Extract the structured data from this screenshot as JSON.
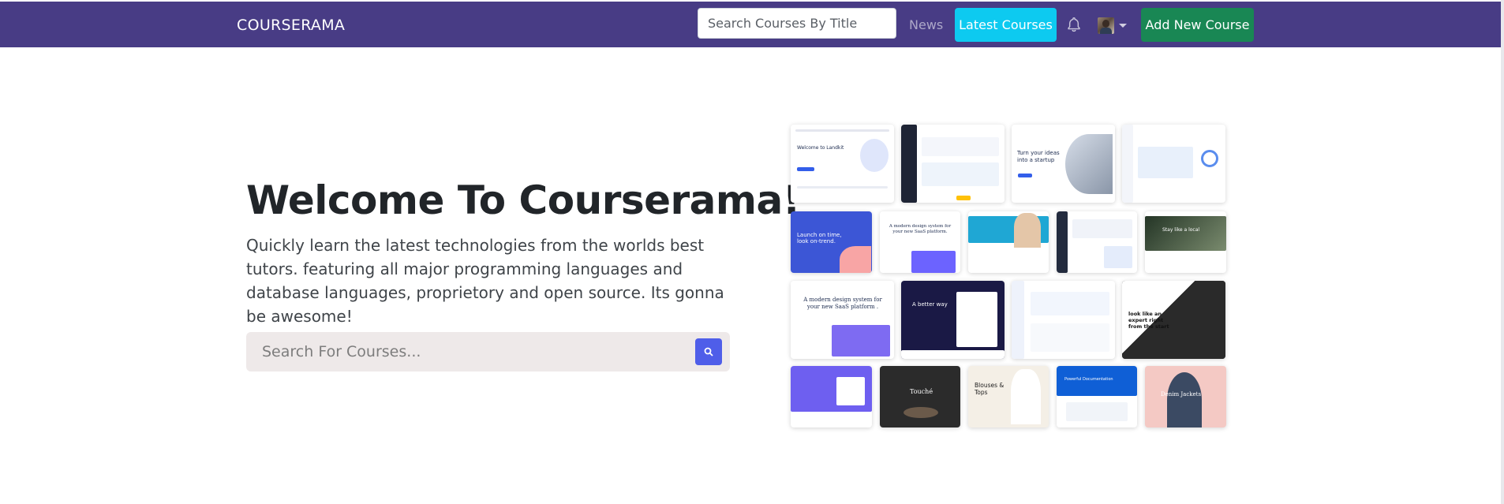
{
  "navbar": {
    "brand": "COURSERAMA",
    "search_placeholder": "Search Courses By Title",
    "news_label": "News",
    "latest_courses_label": "Latest Courses",
    "add_course_label": "Add New Course",
    "bell_icon": "bell-icon",
    "avatar_icon": "user-avatar",
    "dropdown_icon": "caret-down-icon"
  },
  "hero": {
    "title": "Welcome To Courserama!",
    "lead": "Quickly learn the latest technologies from the worlds best tutors. featuring all major programming languages and database languages, proprietory and open source. Its gonna be awesome!",
    "search_placeholder": "Search For Courses...",
    "search_icon": "search-icon"
  },
  "mosaic_texts": {
    "t1": "Welcome to Landkit",
    "t3": "Turn your ideas into a startup",
    "t5": "Launch on time, look on-trend.",
    "t6": "A modern design system for your new SaaS platform.",
    "t10": "Stay like a local",
    "t11": "A modern design system for your new SaaS platform .",
    "t12": "A better way",
    "t14": "look like an expert right from the start",
    "t16": "Touché",
    "t17": "Blouses & Tops",
    "t18": "Powerful Documentation",
    "t19": "Denim Jackets"
  },
  "colors": {
    "navbar": "#483c85",
    "latest_button": "#0dcaf0",
    "add_button": "#198754",
    "search_button": "#4f5ee9"
  }
}
